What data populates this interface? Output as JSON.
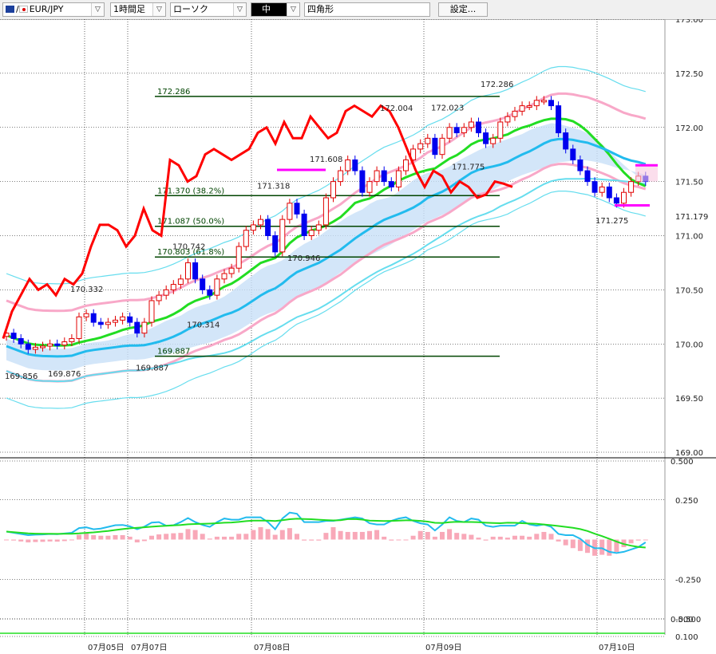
{
  "toolbar": {
    "symbol": "EUR/JPY",
    "symbol_separator": "/",
    "timeframe": "1時間足",
    "chart_style": "ローソク",
    "line_width": "中",
    "drawing_tool": "四角形",
    "settings_label": "設定...",
    "dropdown_glyph": "▽"
  },
  "colors": {
    "background": "#ffffff",
    "grid": "#000000",
    "bull_candle": "#e00000",
    "bear_candle": "#0000ee",
    "fast_line_red": "#ff0000",
    "ma_green": "#22dd22",
    "ma_cyan": "#22bbee",
    "bollinger_pink": "#f8a8c8",
    "bollinger_cyan": "#66ddee",
    "cloud": "#c8e0f8",
    "fib_line": "#004400",
    "magenta_box": "#ff00ff"
  },
  "chart_data": [
    {
      "type": "line",
      "title": "",
      "y_axis_ticks": [
        "173.00",
        "172.50",
        "172.00",
        "171.50",
        "171.179",
        "171.00",
        "170.50",
        "170.00",
        "169.50",
        "169.00"
      ],
      "y_range": [
        169.0,
        173.0
      ],
      "current_price": "171.179",
      "x_axis_labels": [
        "07月05日",
        "07月07日",
        "07月08日",
        "07月09日",
        "07月10日"
      ],
      "fibonacci_levels": [
        {
          "label": "172.286",
          "value": 172.286
        },
        {
          "label": "171.370 (38.2%)",
          "value": 171.37
        },
        {
          "label": "171.087 (50.0%)",
          "value": 171.087
        },
        {
          "label": "170.803 (61.8%)",
          "value": 170.803
        },
        {
          "label": "169.887",
          "value": 169.887
        }
      ],
      "price_annotations": [
        {
          "text": "169.856",
          "value": 169.856
        },
        {
          "text": "169.876",
          "value": 169.876
        },
        {
          "text": "169.887",
          "value": 169.887
        },
        {
          "text": "170.332",
          "value": 170.332
        },
        {
          "text": "170.314",
          "value": 170.314
        },
        {
          "text": "170.742",
          "value": 170.742
        },
        {
          "text": "170.946",
          "value": 170.946
        },
        {
          "text": "171.318",
          "value": 171.318
        },
        {
          "text": "171.608",
          "value": 171.608
        },
        {
          "text": "172.004",
          "value": 172.004
        },
        {
          "text": "172.023",
          "value": 172.023
        },
        {
          "text": "171.775",
          "value": 171.775
        },
        {
          "text": "172.286",
          "value": 172.286
        },
        {
          "text": "171.275",
          "value": 171.275
        }
      ],
      "candles_approx_close": [
        170.1,
        170.05,
        170.0,
        169.95,
        169.97,
        169.98,
        170.0,
        169.99,
        170.02,
        170.05,
        170.25,
        170.28,
        170.2,
        170.18,
        170.2,
        170.22,
        170.25,
        170.2,
        170.1,
        170.2,
        170.4,
        170.45,
        170.5,
        170.55,
        170.6,
        170.75,
        170.6,
        170.5,
        170.45,
        170.6,
        170.65,
        170.7,
        170.9,
        171.05,
        171.1,
        171.15,
        171.0,
        170.85,
        171.15,
        171.3,
        171.2,
        171.0,
        171.05,
        171.1,
        171.35,
        171.5,
        171.6,
        171.7,
        171.6,
        171.4,
        171.5,
        171.6,
        171.5,
        171.45,
        171.6,
        171.7,
        171.8,
        171.85,
        171.9,
        171.75,
        171.9,
        172.0,
        171.95,
        172.0,
        172.05,
        171.95,
        171.85,
        171.9,
        172.05,
        172.1,
        172.15,
        172.2,
        172.2,
        172.25,
        172.25,
        172.2,
        171.95,
        171.8,
        171.7,
        171.6,
        171.5,
        171.4,
        171.45,
        171.35,
        171.3,
        171.4,
        171.5,
        171.55,
        171.5
      ],
      "red_line_approx": [
        170.05,
        170.3,
        170.45,
        170.6,
        170.5,
        170.55,
        170.45,
        170.6,
        170.55,
        170.65,
        170.9,
        171.1,
        171.1,
        171.05,
        170.9,
        171.0,
        171.25,
        171.05,
        171.0,
        171.7,
        171.65,
        171.5,
        171.55,
        171.75,
        171.8,
        171.75,
        171.7,
        171.75,
        171.8,
        171.95,
        172.0,
        171.85,
        172.05,
        171.9,
        171.9,
        172.1,
        172.0,
        171.9,
        171.95,
        172.15,
        172.2,
        172.15,
        172.1,
        172.2,
        172.15,
        172.0,
        171.8,
        171.6,
        171.45,
        171.6,
        171.55,
        171.4,
        171.5,
        171.45,
        171.35,
        171.38,
        171.5,
        171.48,
        171.45
      ],
      "series": [
        {
          "name": "",
          "color": "#22dd22"
        },
        {
          "name": "",
          "color": "#22bbee"
        },
        {
          "name": "",
          "color": "#f8a8c8"
        }
      ]
    },
    {
      "type": "bar",
      "title": "",
      "y_axis_ticks": [
        "0.500",
        "0.250",
        "-0.250",
        "-0.500",
        "0.500",
        "0.100"
      ],
      "y_range": [
        -0.5,
        0.5
      ]
    }
  ]
}
